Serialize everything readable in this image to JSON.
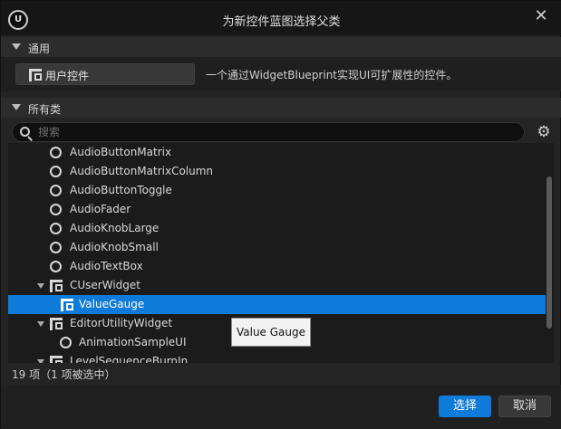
{
  "window": {
    "title": "为新控件蓝图选择父类",
    "logo_text": "U"
  },
  "common_section": {
    "header": "通用",
    "user_widget_button": "用户控件",
    "description": "一个通过WidgetBlueprint实现UI可扩展性的控件。"
  },
  "all_classes_section": {
    "header": "所有类",
    "search_placeholder": "搜索"
  },
  "tree": {
    "items": [
      {
        "label": "AudioButtonMatrix",
        "icon": "circle-class-icon"
      },
      {
        "label": "AudioButtonMatrixColumn",
        "icon": "circle-class-icon"
      },
      {
        "label": "AudioButtonToggle",
        "icon": "circle-class-icon"
      },
      {
        "label": "AudioFader",
        "icon": "circle-class-icon"
      },
      {
        "label": "AudioKnobLarge",
        "icon": "circle-class-icon"
      },
      {
        "label": "AudioKnobSmall",
        "icon": "circle-class-icon"
      },
      {
        "label": "AudioTextBox",
        "icon": "circle-class-icon"
      },
      {
        "label": "CUserWidget",
        "icon": "widget-icon",
        "expanded": true
      },
      {
        "label": "ValueGauge",
        "icon": "widget-icon",
        "selected": true
      },
      {
        "label": "EditorUtilityWidget",
        "icon": "widget-icon",
        "expanded": true
      },
      {
        "label": "AnimationSampleUI",
        "icon": "circle-class-icon"
      },
      {
        "label": "LevelSequenceBurnIn",
        "icon": "widget-icon",
        "expanded": true
      }
    ]
  },
  "tooltip": "Value Gauge",
  "status": "19 项（1 项被选中）",
  "buttons": {
    "select": "选择",
    "cancel": "取消"
  },
  "colors": {
    "accent": "#0e7ad9",
    "background": "#242424",
    "titlebar": "#161616"
  }
}
